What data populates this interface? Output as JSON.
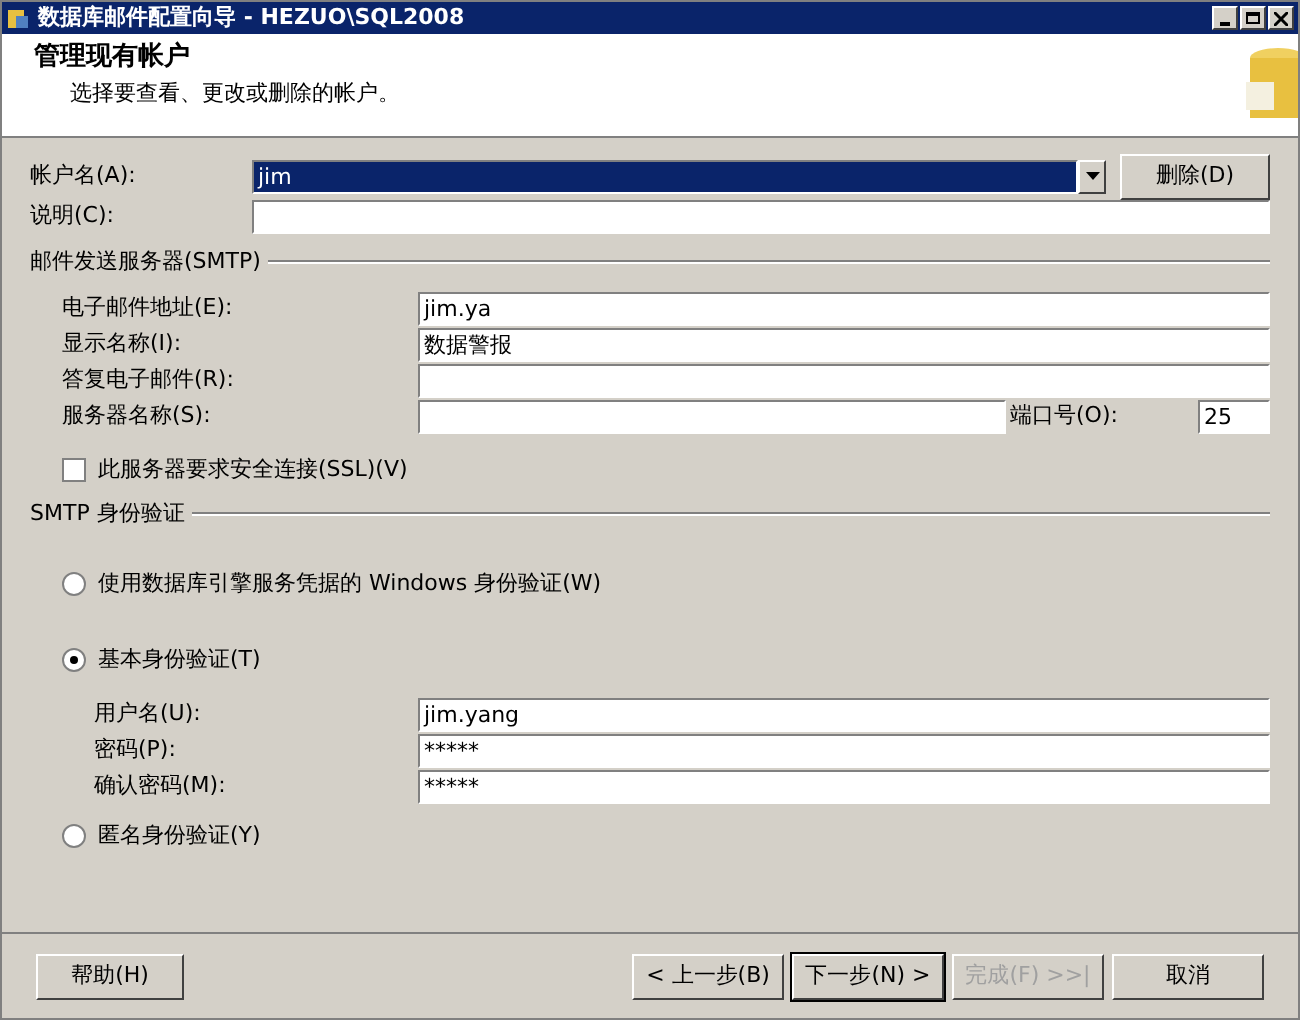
{
  "window": {
    "title": "数据库邮件配置向导 - HEZUO\\SQL2008"
  },
  "header": {
    "title": "管理现有帐户",
    "subtitle": "选择要查看、更改或删除的帐户。"
  },
  "account": {
    "label": "帐户名(A):",
    "value": "jim",
    "delete_button": "删除(D)",
    "description_label": "说明(C):"
  },
  "smtp": {
    "title": "邮件发送服务器(SMTP)",
    "fields": [
      {
        "label": "电子邮件地址(E):",
        "value": "jim.ya"
      },
      {
        "label": "显示名称(I):",
        "value": "数据警报"
      },
      {
        "label": "答复电子邮件(R):"
      },
      {
        "label": "服务器名称(S):"
      }
    ],
    "port": {
      "label": "端口号(O):",
      "value": "25"
    },
    "ssl": {
      "label": "此服务器要求安全连接(SSL)(V)",
      "checked": false
    }
  },
  "auth": {
    "title": "SMTP 身份验证",
    "options": [
      {
        "label": "使用数据库引擎服务凭据的 Windows 身份验证(W)",
        "selected": false
      },
      {
        "label": "基本身份验证(T)",
        "selected": true,
        "fields": [
          {
            "label": "用户名(U):",
            "value": "jim.yang"
          },
          {
            "label": "密码(P):",
            "value": "*****"
          },
          {
            "label": "确认密码(M):",
            "value": "*****"
          }
        ]
      },
      {
        "label": "匿名身份验证(Y)",
        "selected": false
      }
    ]
  },
  "buttons": [
    {
      "label": "帮助(H)",
      "disabled": false,
      "default": false
    },
    {
      "label": "< 上一步(B)",
      "disabled": false,
      "default": false
    },
    {
      "label": "下一步(N) >",
      "disabled": false,
      "default": true
    },
    {
      "label": "完成(F) >>|",
      "disabled": true,
      "default": false
    },
    {
      "label": "取消",
      "disabled": false,
      "default": false
    }
  ]
}
